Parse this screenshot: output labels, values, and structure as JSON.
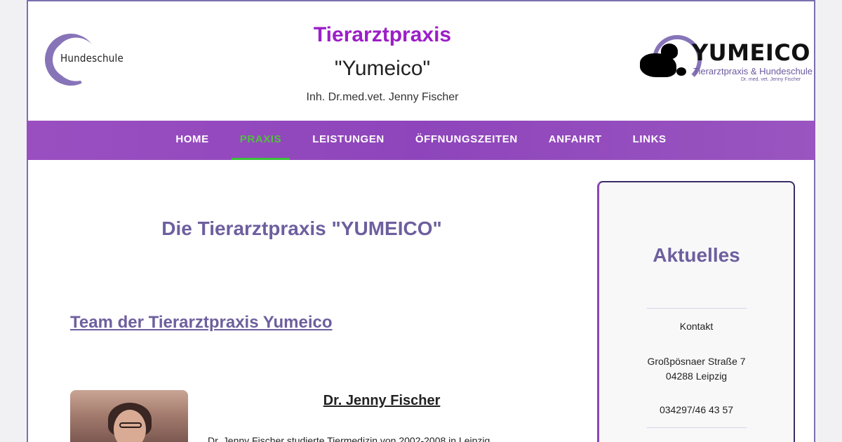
{
  "header": {
    "left_logo_text": "Hundeschule",
    "title": "Tierarztpraxis",
    "subtitle": "\"Yumeico\"",
    "owner": "Inh. Dr.med.vet. Jenny Fischer",
    "right_logo": {
      "brand": "YUMEICO",
      "tagline": "Tierarztpraxis & Hundeschule",
      "small": "Dr. med. vet. Jenny Fischer"
    }
  },
  "nav": {
    "items": [
      {
        "label": "HOME"
      },
      {
        "label": "PRAXIS",
        "active": true
      },
      {
        "label": "LEISTUNGEN"
      },
      {
        "label": "ÖFFNUNGSZEITEN"
      },
      {
        "label": "ANFAHRT"
      },
      {
        "label": "LINKS"
      }
    ]
  },
  "main": {
    "heading": "Die Tierarztpraxis \"YUMEICO\"",
    "team_heading": "Team der Tierarztpraxis Yumeico",
    "person": {
      "name": "Dr. Jenny Fischer",
      "bio": "Dr. Jenny Fischer studierte Tiermedizin von 2002-2008 in Leipzig"
    }
  },
  "sidebar": {
    "title": "Aktuelles",
    "contact_label": "Kontakt",
    "street": "Großpösnaer Straße 7",
    "city": "04288 Leipzig",
    "phone": "034297/46 43 57"
  },
  "colors": {
    "accent_purple": "#9b1fc7",
    "nav_bg": "#8e45bb",
    "active_green": "#4fc23c",
    "heading_purple": "#6e5f9e"
  }
}
